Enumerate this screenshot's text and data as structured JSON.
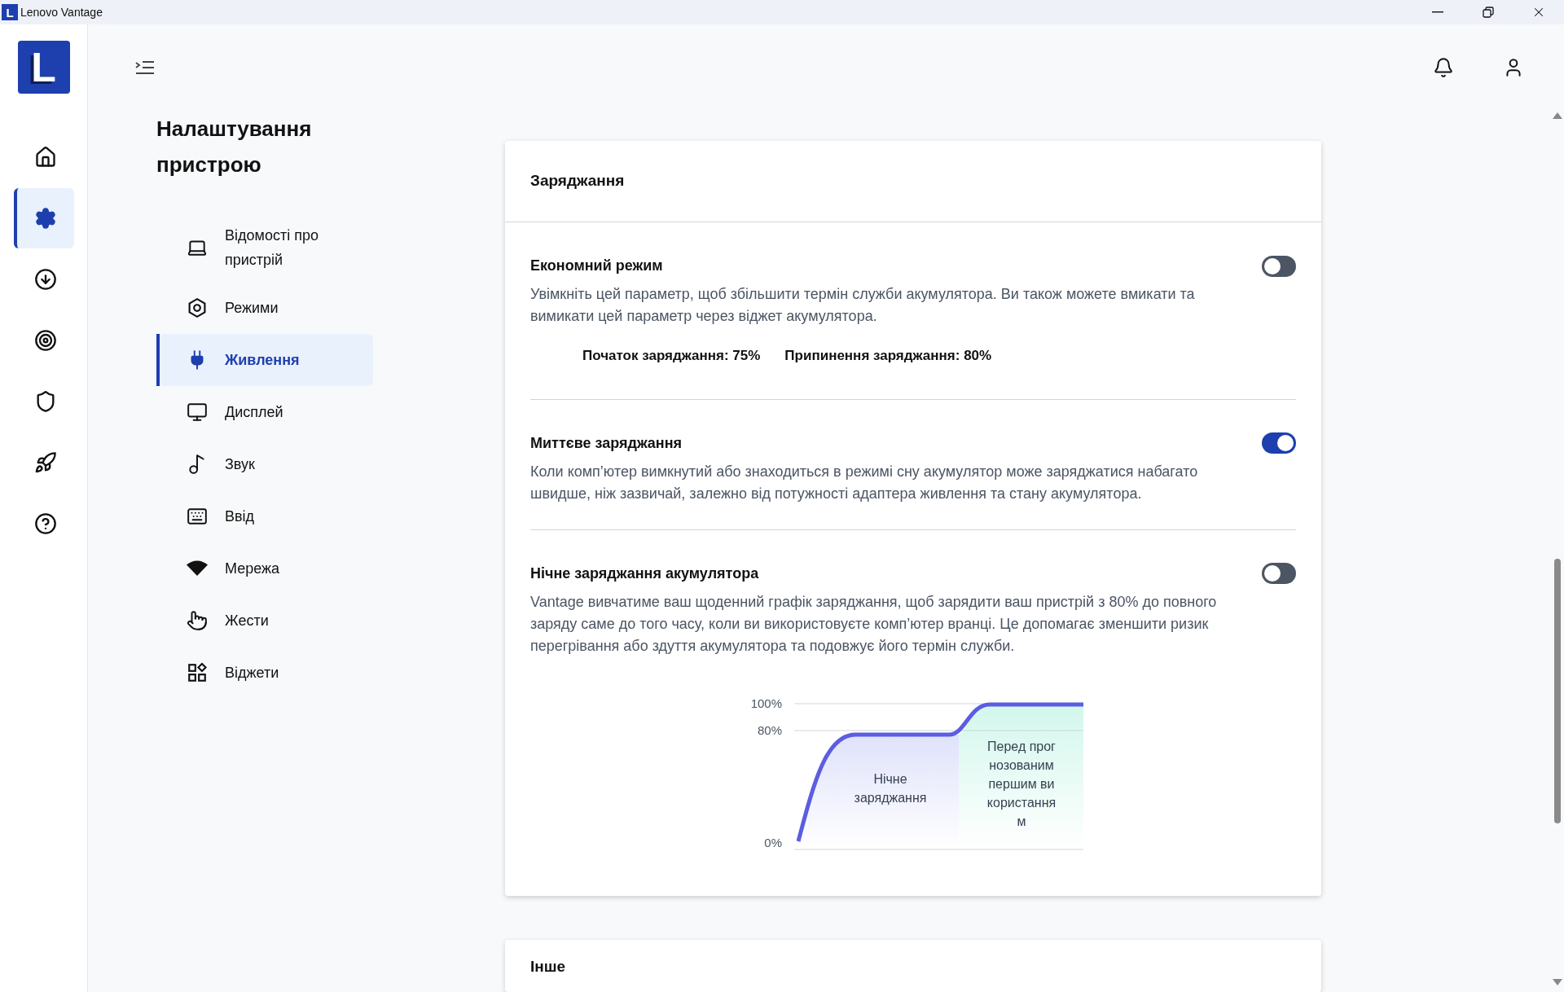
{
  "window": {
    "icon_letter": "L",
    "title": "Lenovo Vantage"
  },
  "rail": {
    "logo": "L",
    "items": [
      {
        "selected": false
      },
      {
        "selected": true
      },
      {
        "selected": false
      },
      {
        "selected": false
      },
      {
        "selected": false
      },
      {
        "selected": false
      },
      {
        "selected": false
      }
    ]
  },
  "page_title": "Налаштування пристрою",
  "settings_nav": [
    {
      "label": "Відомості про пристрій",
      "selected": false
    },
    {
      "label": "Режими",
      "selected": false
    },
    {
      "label": "Живлення",
      "selected": true
    },
    {
      "label": "Дисплей",
      "selected": false
    },
    {
      "label": "Звук",
      "selected": false
    },
    {
      "label": "Ввід",
      "selected": false
    },
    {
      "label": "Мережа",
      "selected": false
    },
    {
      "label": "Жести",
      "selected": false
    },
    {
      "label": "Віджети",
      "selected": false
    }
  ],
  "card": {
    "title": "Заряджання",
    "sections": [
      {
        "title": "Економний режим",
        "on": false,
        "description": "Увімкніть цей параметр, щоб збільшити термін служби акумулятора. Ви також можете вмикати та вимикати цей параметр через віджет акумулятора.",
        "thresholds": [
          "Початок заряджання: 75%",
          "Припинення заряджання: 80%"
        ]
      },
      {
        "title": "Миттєве заряджання",
        "on": true,
        "description": "Коли комп’ютер вимкнутий або знаходиться в режимі сну акумулятор може заряджатися набагато швидше, ніж зазвичай, залежно від потужності адаптера живлення та стану акумулятора."
      },
      {
        "title": "Нічне заряджання акумулятора",
        "on": false,
        "description": "Vantage вивчатиме ваш щоденний графік заряджання, щоб зарядити ваш пристрій з 80% до повного заряду саме до того часу, коли ви використовуєте комп’ютер вранці. Це допомагає зменшити ризик перегрівання або здуття акумулятора та подовжує його термін служби.",
        "illustration": {
          "ticks": [
            "100%",
            "80%",
            "0%"
          ],
          "regions": [
            "Нічне заряджання",
            "Перед прогнозованим першим використанням"
          ]
        }
      }
    ]
  },
  "next_card": {
    "title": "Інше"
  }
}
